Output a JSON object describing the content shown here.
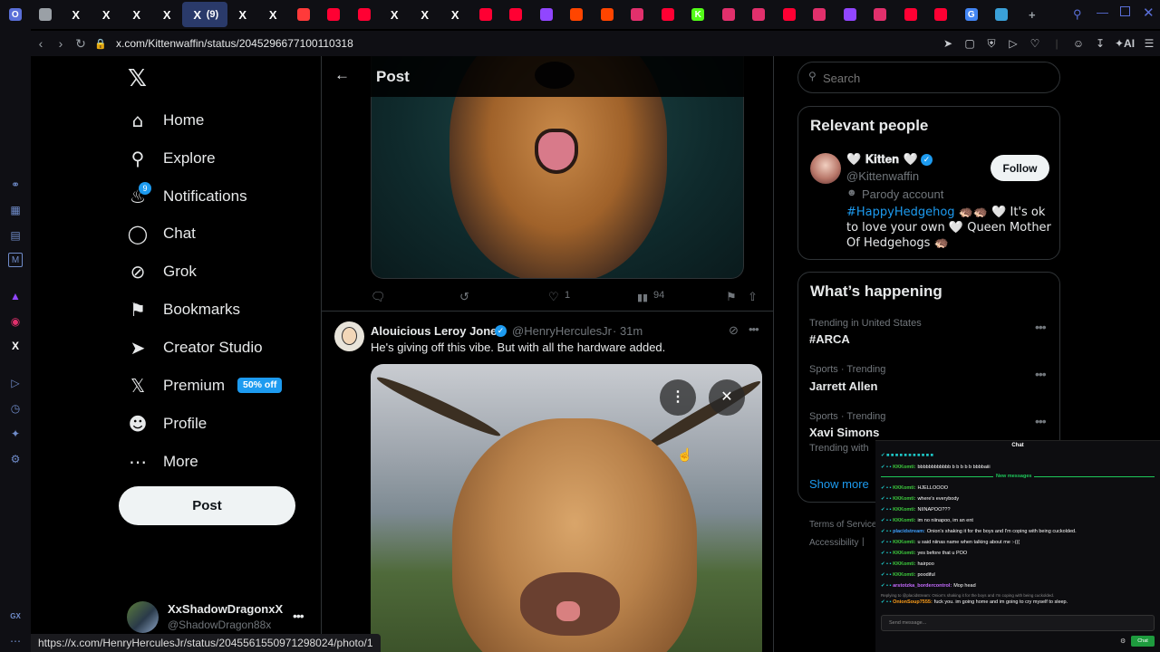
{
  "browser": {
    "tabs": [
      {
        "icon": "opera-logo-icon",
        "color": "#5a6fd8",
        "label": "O"
      },
      {
        "icon": "gamepad-icon",
        "color": "#9aa0a6",
        "label": ""
      },
      {
        "icon": "x-logo-icon",
        "color": "#ffffff",
        "label": "X"
      },
      {
        "icon": "x-logo-icon",
        "color": "#ffffff",
        "label": "X"
      },
      {
        "icon": "x-logo-icon",
        "color": "#ffffff",
        "label": "X"
      },
      {
        "icon": "x-logo-icon",
        "color": "#ffffff",
        "label": "X"
      },
      {
        "icon": "x-logo-icon",
        "color": "#ffffff",
        "label": "X",
        "active": true,
        "count": "(9)"
      },
      {
        "icon": "x-logo-icon",
        "color": "#ffffff",
        "label": "X"
      },
      {
        "icon": "x-logo-icon",
        "color": "#ffffff",
        "label": "X"
      },
      {
        "icon": "bolt-icon",
        "color": "#ff3a3a",
        "label": ""
      },
      {
        "icon": "youtube-icon",
        "color": "#ff0033",
        "label": ""
      },
      {
        "icon": "youtube-icon",
        "color": "#ff0033",
        "label": ""
      },
      {
        "icon": "x-logo-icon",
        "color": "#ffffff",
        "label": "X"
      },
      {
        "icon": "x-logo-icon",
        "color": "#ffffff",
        "label": "X"
      },
      {
        "icon": "x-logo-icon",
        "color": "#ffffff",
        "label": "X"
      },
      {
        "icon": "play-icon",
        "color": "#ff0033",
        "label": ""
      },
      {
        "icon": "play-icon",
        "color": "#ff0033",
        "label": ""
      },
      {
        "icon": "twitch-icon",
        "color": "#9146ff",
        "label": ""
      },
      {
        "icon": "reddit-icon",
        "color": "#ff4500",
        "label": ""
      },
      {
        "icon": "reddit-icon",
        "color": "#ff4500",
        "label": ""
      },
      {
        "icon": "instagram-icon",
        "color": "#e1306c",
        "label": ""
      },
      {
        "icon": "youtube-icon",
        "color": "#ff0033",
        "label": ""
      },
      {
        "icon": "kick-icon",
        "color": "#53fc18",
        "label": "K"
      },
      {
        "icon": "instagram-icon",
        "color": "#e1306c",
        "label": ""
      },
      {
        "icon": "instagram-icon",
        "color": "#e1306c",
        "label": ""
      },
      {
        "icon": "youtube-icon",
        "color": "#ff0033",
        "label": ""
      },
      {
        "icon": "instagram-icon",
        "color": "#e1306c",
        "label": ""
      },
      {
        "icon": "twitch-icon",
        "color": "#9146ff",
        "label": ""
      },
      {
        "icon": "instagram-icon",
        "color": "#e1306c",
        "label": ""
      },
      {
        "icon": "youtube-icon",
        "color": "#ff0033",
        "label": ""
      },
      {
        "icon": "youtube-icon",
        "color": "#ff0033",
        "label": ""
      },
      {
        "icon": "google-icon",
        "color": "#4285f4",
        "label": "G"
      },
      {
        "icon": "app-icon",
        "color": "#3aa0d8",
        "label": ""
      }
    ],
    "url": "x.com/Kittenwaffin/status/2045296677100110318",
    "status_url": "https://x.com/HenryHerculesJr/status/2045561550971298024/photo/1",
    "ai_label": "AI"
  },
  "nav": {
    "items": [
      {
        "label": "Home",
        "icon": "home-icon"
      },
      {
        "label": "Explore",
        "icon": "search-icon"
      },
      {
        "label": "Notifications",
        "icon": "bell-icon"
      },
      {
        "label": "Chat",
        "icon": "chat-icon"
      },
      {
        "label": "Grok",
        "icon": "grok-icon"
      },
      {
        "label": "Bookmarks",
        "icon": "bookmark-icon"
      },
      {
        "label": "Creator Studio",
        "icon": "rocket-icon"
      },
      {
        "label": "Premium",
        "icon": "x-logo-icon"
      },
      {
        "label": "Profile",
        "icon": "person-icon"
      },
      {
        "label": "More",
        "icon": "more-circle-icon"
      }
    ],
    "notifications_count": "9",
    "premium_badge": "50% off",
    "post_button": "Post",
    "account": {
      "name": "XxShadowDragonxX",
      "handle": "@ShadowDragon88x"
    }
  },
  "header": {
    "title": "Post"
  },
  "first_post": {
    "actions": {
      "replies": "",
      "reposts": "",
      "likes": "1",
      "views": "94"
    }
  },
  "reply": {
    "name": "Alouicious Leroy Jones",
    "handle": "@HenryHerculesJr",
    "time": "· 31m",
    "text": "He's giving off this vibe. But with all the hardware added."
  },
  "search": {
    "placeholder": "Search"
  },
  "relevant": {
    "title": "Relevant people",
    "name": "🤍 𝐊𝐢𝐭𝐭𝐞𝐧 🤍",
    "handle": "@Kittenwaffin",
    "parody": "Parody account",
    "follow": "Follow",
    "bio_tag": "#HappyHedgehog",
    "bio_text": " 🦔🦔 🤍 It's ok to love your own 🤍 Queen Mother Of Hedgehogs 🦔"
  },
  "happening": {
    "title": "What’s happening",
    "trends": [
      {
        "meta": "Trending in United States",
        "title": "#ARCA"
      },
      {
        "meta": "Sports · Trending",
        "title": "Jarrett Allen"
      },
      {
        "meta": "Sports · Trending",
        "title": "Xavi Simons",
        "sub": "Trending with"
      }
    ],
    "show_more": "Show more",
    "footer": [
      "Terms of Service",
      "Accessibility"
    ]
  },
  "chat": {
    "title": "Chat",
    "new_messages": "New messages",
    "messages": [
      {
        "user": "KKKomti:",
        "text": "bbbbbbbbbbbb b b b b b bbbbaiii",
        "cls": "u"
      },
      {
        "user": "KKKomti:",
        "text": "HJELLOOOO",
        "cls": "u"
      },
      {
        "user": "KKKomti:",
        "text": "where's everybody",
        "cls": "u"
      },
      {
        "user": "KKKomti:",
        "text": "NIINAPOO???",
        "cls": "u"
      },
      {
        "user": "KKKomti:",
        "text": "im no niinapoo, im an ent",
        "cls": "u"
      },
      {
        "user": "placidstream:",
        "text": "Onion's shaking it for the boys and I'm coping with being cuckolded.",
        "cls": "u2"
      },
      {
        "user": "KKKomti:",
        "text": "u said niinas name when talking about me :-(((",
        "cls": "u"
      },
      {
        "user": "KKKomti:",
        "text": "yes before that u POO",
        "cls": "u"
      },
      {
        "user": "KKKomti:",
        "text": "hairpoo",
        "cls": "u"
      },
      {
        "user": "KKKomti:",
        "text": "poodiful",
        "cls": "u"
      },
      {
        "user": "arstotzka_bordercontrol:",
        "text": "Mop head",
        "cls": "u3"
      },
      {
        "user": "OnionSoup7555:",
        "text": "fuck you. im going home and im going to cry myself to sleep.",
        "cls": "u4"
      }
    ],
    "reply_note": "Replying to @placidstream: Onion's shaking it for the boys and I'm coping with being cuckolded.",
    "input_placeholder": "Send message...",
    "chat_button": "Chat"
  }
}
